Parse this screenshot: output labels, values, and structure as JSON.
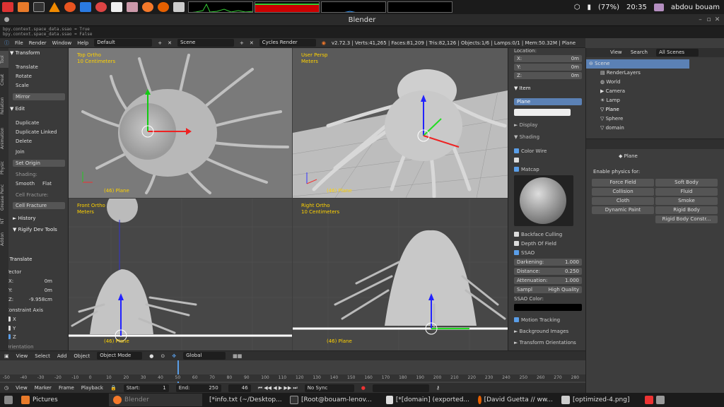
{
  "top_bar": {
    "battery": "(77%)",
    "time": "20:35",
    "user": "abdou bouam"
  },
  "window": {
    "title": "Blender"
  },
  "info_lines": [
    "bpy.context.space_data.ssao = True",
    "bpy.context.space_data.ssao = False"
  ],
  "header": {
    "menus": [
      "File",
      "Render",
      "Window",
      "Help"
    ],
    "layout": "Default",
    "scene": "Scene",
    "engine": "Cycles Render",
    "stats": "v2.72.3 | Verts:41,265 | Faces:81,209 | Tris:82,126 | Objects:1/6 | Lamps:0/1 | Mem:50.32M | Plane"
  },
  "toolshelf": {
    "tabs": [
      "Tool",
      "Creat",
      "Relation",
      "Animation",
      "Physic",
      "Grease Penc",
      "NT",
      "Addon"
    ],
    "transform_header": "Transform",
    "transform_buttons": [
      "Translate",
      "Rotate",
      "Scale",
      "Mirror"
    ],
    "edit_header": "Edit",
    "edit_buttons": [
      "Duplicate",
      "Duplicate Linked",
      "Delete",
      "Join",
      "Set Origin"
    ],
    "shading_label": "Shading:",
    "smooth": "Smooth",
    "flat": "Flat",
    "cell_fracture_label": "Cell Fracture:",
    "cell_fracture": "Cell Fracture",
    "history": "History",
    "rigify": "Rigify Dev Tools",
    "operator_header": "Translate",
    "vector_label": "Vector",
    "x": "X:",
    "x_val": "0m",
    "y": "Y:",
    "y_val": "0m",
    "z": "Z:",
    "z_val": "-9.958cm",
    "constraint_label": "Constraint Axis",
    "cx": "X",
    "cy": "Y",
    "cz": "Z",
    "orientation": "Orientation"
  },
  "viewports": {
    "top": {
      "name": "Top Ortho",
      "unit": "10 Centimeters",
      "foot": "(46) Plane"
    },
    "persp": {
      "name": "User Persp",
      "unit": "Meters",
      "foot": "(46) Plane"
    },
    "front": {
      "name": "Front Ortho",
      "unit": "Meters",
      "foot": "(46) Plane"
    },
    "right": {
      "name": "Right Ortho",
      "unit": "10 Centimeters",
      "foot": "(46) Plane"
    }
  },
  "npanel": {
    "location": "Location:",
    "x": "X:",
    "y": "Y:",
    "z": "Z:",
    "xv": "0m",
    "yv": "0m",
    "zv": "0m",
    "item": "Item",
    "object_name": "Plane",
    "display": "Display",
    "shading": "Shading",
    "color_wire": "Color Wire",
    "matcap": "Matcap",
    "backface": "Backface Culling",
    "dof": "Depth Of Field",
    "ssao": "SSAO",
    "darkening": "Darkening:",
    "darkening_v": "1.000",
    "distance": "Distance:",
    "distance_v": "0.250",
    "attenuation": "Attenuation:",
    "attenuation_v": "1.000",
    "samples": "Sampl",
    "samples_v": "High Quality",
    "ssao_color": "SSAO Color:",
    "motion": "Motion Tracking",
    "bg_images": "Background Images",
    "transform_orient": "Transform Orientations"
  },
  "outliner": {
    "view": "View",
    "search": "Search",
    "filter": "All Scenes",
    "items": [
      "Scene",
      "RenderLayers",
      "World",
      "Camera",
      "Lamp",
      "Plane",
      "Sphere",
      "domain"
    ]
  },
  "properties": {
    "object": "Plane",
    "enable_label": "Enable physics for:",
    "buttons": [
      "Force Field",
      "Soft Body",
      "Collision",
      "Fluid",
      "Cloth",
      "Smoke",
      "Dynamic Paint",
      "Rigid Body",
      "",
      "Rigid Body Constr..."
    ]
  },
  "viewport_header": {
    "items": [
      "View",
      "Select",
      "Add",
      "Object"
    ],
    "mode": "Object Mode",
    "orientation": "Global"
  },
  "timeline": {
    "items": [
      "View",
      "Marker",
      "Frame",
      "Playback"
    ],
    "start": "Start:",
    "start_v": "1",
    "end": "End:",
    "end_v": "250",
    "current": "46",
    "sync": "No Sync",
    "ticks": [
      "-50",
      "-40",
      "-30",
      "-20",
      "-10",
      "0",
      "10",
      "20",
      "30",
      "40",
      "50",
      "60",
      "70",
      "80",
      "90",
      "100",
      "110",
      "120",
      "130",
      "140",
      "150",
      "160",
      "170",
      "180",
      "190",
      "200",
      "210",
      "220",
      "230",
      "240",
      "250",
      "260",
      "270",
      "280"
    ]
  },
  "taskbar": {
    "items": [
      "Pictures",
      "Blender",
      "[*info.txt (~/Desktop...",
      "[Root@bouam-lenov...",
      "[*[domain] (exported...",
      "[David Guetta // ww...",
      "[optimized-4.png]"
    ]
  },
  "colors": {
    "accent": "#5a9ee8",
    "viewport_label": "#ffd200",
    "selected": "#5b81b5"
  }
}
